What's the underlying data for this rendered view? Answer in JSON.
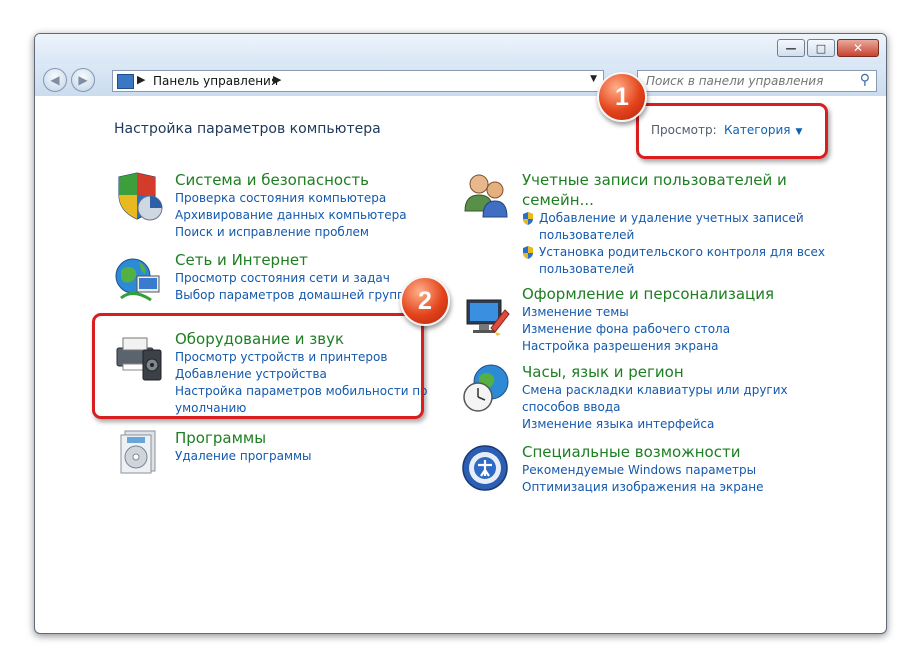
{
  "window": {
    "controls": {
      "minimize": "—",
      "maximize": "□",
      "close": "✕"
    }
  },
  "address_bar": {
    "breadcrumb": "Панель управления"
  },
  "search": {
    "placeholder": "Поиск в панели управления"
  },
  "heading": "Настройка параметров компьютера",
  "view": {
    "label": "Просмотр:",
    "value": "Категория"
  },
  "categories_left": [
    {
      "title": "Система и безопасность",
      "links": [
        "Проверка состояния компьютера",
        "Архивирование данных компьютера",
        "Поиск и исправление проблем"
      ]
    },
    {
      "title": "Сеть и Интернет",
      "links": [
        "Просмотр состояния сети и задач",
        "Выбор параметров домашней группы и"
      ]
    },
    {
      "title": "Оборудование и звук",
      "links": [
        "Просмотр устройств и принтеров",
        "Добавление устройства",
        "Настройка параметров мобильности по",
        "умолчанию"
      ]
    },
    {
      "title": "Программы",
      "links": [
        "Удаление программы"
      ]
    }
  ],
  "categories_right": [
    {
      "title_line1": "Учетные записи пользователей и",
      "title_line2": "семейн...",
      "links": [
        "Добавление и удаление учетных записей",
        "пользователей",
        "Установка родительского контроля для всех",
        "пользователей"
      ]
    },
    {
      "title": "Оформление и персонализация",
      "links": [
        "Изменение темы",
        "Изменение фона рабочего стола",
        "Настройка разрешения экрана"
      ]
    },
    {
      "title": "Часы, язык и регион",
      "links": [
        "Смена раскладки клавиатуры или других",
        "способов ввода",
        "Изменение языка интерфейса"
      ]
    },
    {
      "title": "Специальные возможности",
      "links": [
        "Рекомендуемые Windows параметры",
        "Оптимизация изображения на экране"
      ]
    }
  ],
  "annotations": {
    "badge1": "1",
    "badge2": "2"
  },
  "colors": {
    "category_title": "#1e7e22",
    "link": "#1459ad",
    "annotation_red": "#d81e1e"
  }
}
